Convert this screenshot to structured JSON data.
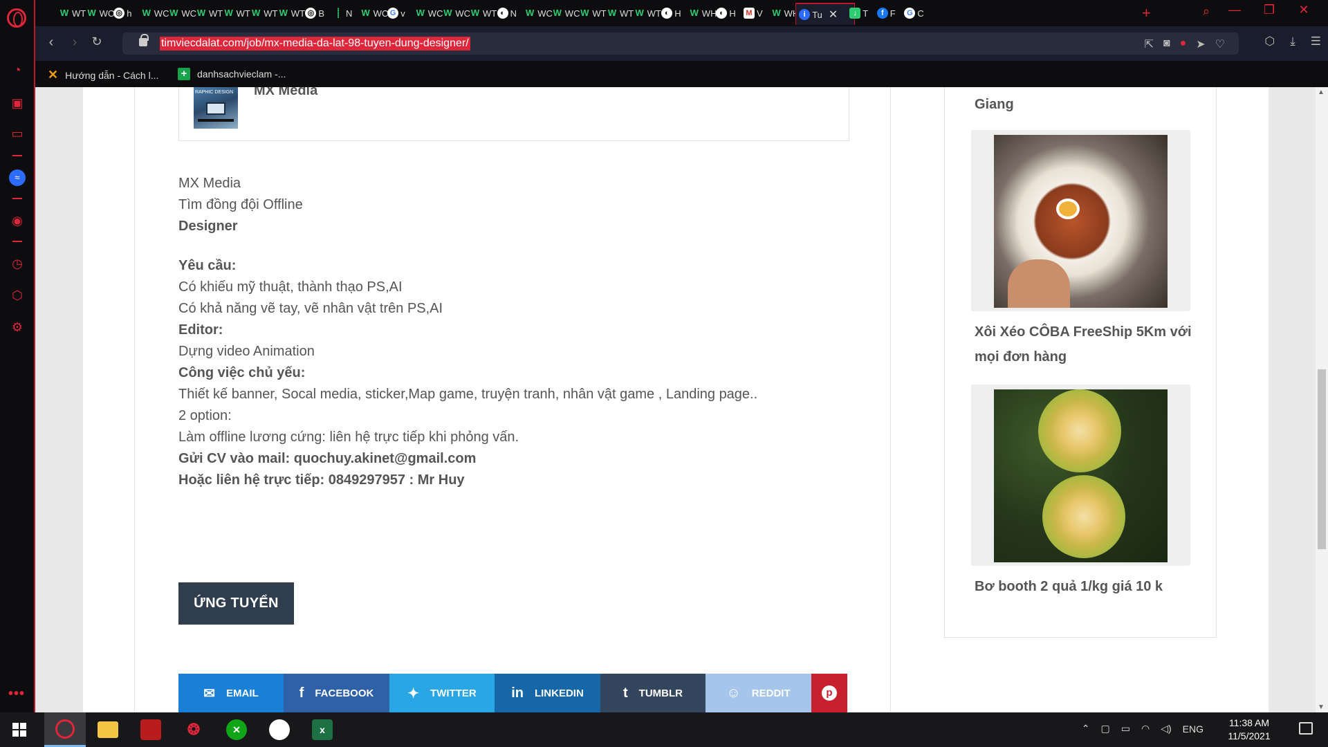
{
  "browser": {
    "tabs": [
      {
        "icon": "wt-icon",
        "label": "WT"
      },
      {
        "icon": "wt-icon",
        "label": "WC"
      },
      {
        "icon": "opera-icon",
        "label": "h"
      },
      {
        "icon": "wt-icon",
        "label": "WC"
      },
      {
        "icon": "wt-icon",
        "label": "WC"
      },
      {
        "icon": "wt-icon",
        "label": "WT"
      },
      {
        "icon": "wt-icon",
        "label": "WT"
      },
      {
        "icon": "wt-icon",
        "label": "WT"
      },
      {
        "icon": "wt-icon",
        "label": "WT"
      },
      {
        "icon": "opera-icon",
        "label": "B"
      },
      {
        "icon": "chart-icon",
        "label": "N"
      },
      {
        "icon": "wt-icon",
        "label": "WC"
      },
      {
        "icon": "google-icon",
        "label": "v"
      },
      {
        "icon": "wt-icon",
        "label": "WC"
      },
      {
        "icon": "wt-icon",
        "label": "WC"
      },
      {
        "icon": "wt-icon",
        "label": "WT"
      },
      {
        "icon": "page-icon",
        "label": "N"
      },
      {
        "icon": "wt-icon",
        "label": "WC"
      },
      {
        "icon": "wt-icon",
        "label": "WC"
      },
      {
        "icon": "wt-icon",
        "label": "WT"
      },
      {
        "icon": "wt-icon",
        "label": "WT"
      },
      {
        "icon": "wt-icon",
        "label": "WT"
      },
      {
        "icon": "page-icon",
        "label": "H"
      },
      {
        "icon": "wt-icon",
        "label": "WH"
      },
      {
        "icon": "page-icon",
        "label": "H"
      },
      {
        "icon": "gmail-icon",
        "label": "V"
      },
      {
        "icon": "wt-icon",
        "label": "WH"
      }
    ],
    "active_tab": {
      "icon": "info-icon",
      "label": "Tu"
    },
    "tabs_after": [
      {
        "icon": "download-icon",
        "label": "T"
      },
      {
        "icon": "facebook-icon",
        "label": "F"
      },
      {
        "icon": "google-icon",
        "label": "C"
      }
    ],
    "url": "timviecdalat.com/job/mx-media-da-lat-98-tuyen-dung-designer/",
    "bookmarks": [
      {
        "label": "Hướng dẫn - Cách l...",
        "icon": "x-icon"
      },
      {
        "label": "danhsachvieclam -...",
        "icon": "sheets-icon"
      }
    ]
  },
  "page": {
    "company_name": "MX Media",
    "job_lines": [
      {
        "text": "MX Media",
        "bold": false
      },
      {
        "text": "Tìm đồng đội Offline",
        "bold": false
      },
      {
        "text": "Designer",
        "bold": true
      },
      {
        "text": "Yêu cầu:",
        "bold": true
      },
      {
        "text": "Có khiếu mỹ thuật, thành thạo PS,AI",
        "bold": false
      },
      {
        "text": "Có khả năng vẽ tay, vẽ nhân vật trên PS,AI",
        "bold": false
      },
      {
        "text": "Editor:",
        "bold": true
      },
      {
        "text": "Dựng video Animation",
        "bold": false
      },
      {
        "text": "Công việc chủ yếu:",
        "bold": true
      },
      {
        "text": "Thiết kế banner, Socal media, sticker,Map game, truyện tranh, nhân vật game , Landing page..",
        "bold": false
      },
      {
        "text": "2 option:",
        "bold": false
      },
      {
        "text": "Làm offline lương cứng: liên hệ trực tiếp khi phỏng vấn.",
        "bold": false
      },
      {
        "text": "Gửi CV vào mail: quochuy.akinet@gmail.com",
        "bold": true
      },
      {
        "text": "Hoặc liên hệ trực tiếp: 0849297957 : Mr Huy",
        "bold": true
      }
    ],
    "apply_label": "ỨNG TUYỂN",
    "share": [
      {
        "label": "EMAIL",
        "icon": "email-icon"
      },
      {
        "label": "FACEBOOK",
        "icon": "facebook-icon"
      },
      {
        "label": "TWITTER",
        "icon": "twitter-icon"
      },
      {
        "label": "LINKEDIN",
        "icon": "linkedin-icon"
      },
      {
        "label": "TUMBLR",
        "icon": "tumblr-icon"
      },
      {
        "label": "REDDIT",
        "icon": "reddit-icon"
      },
      {
        "label": "",
        "icon": "pinterest-icon"
      }
    ]
  },
  "sidebar_widget": {
    "top_title": "Giang",
    "cards": [
      {
        "title": "Xôi Xéo CÔBA FreeShip 5Km với mọi đơn hàng",
        "image": "food-bowl-photo"
      },
      {
        "title": "Bơ booth 2 quả 1/kg giá 10 k",
        "image": "avocado-photo"
      }
    ]
  },
  "taskbar": {
    "apps": [
      "opera-icon",
      "file-explorer-icon",
      "red-app-icon",
      "garena-icon",
      "xbox-icon",
      "zalo-icon",
      "excel-icon"
    ],
    "language": "ENG",
    "time": "11:38 AM",
    "date": "11/5/2021"
  }
}
